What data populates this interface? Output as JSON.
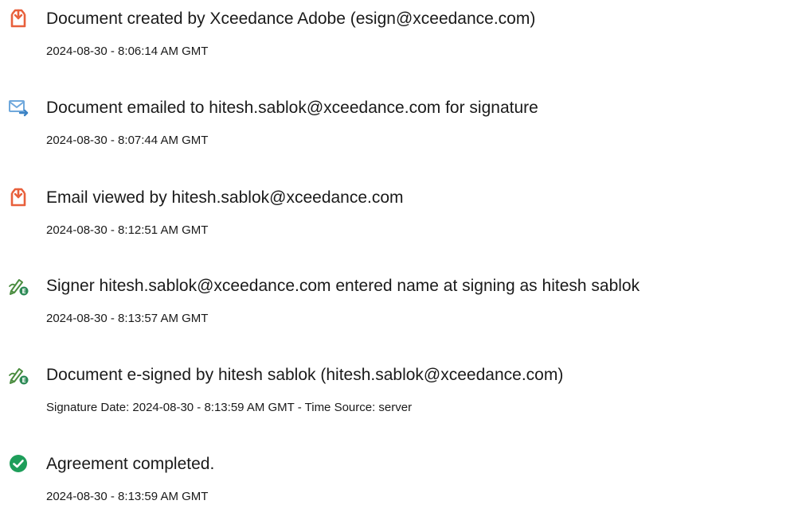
{
  "events": [
    {
      "icon": "document-created-icon",
      "title": "Document created by Xceedance Adobe (esign@xceedance.com)",
      "meta": "2024-08-30 - 8:06:14 AM GMT"
    },
    {
      "icon": "email-sent-icon",
      "title": "Document emailed to hitesh.sablok@xceedance.com for signature",
      "meta": "2024-08-30 - 8:07:44 AM GMT"
    },
    {
      "icon": "document-viewed-icon",
      "title": "Email viewed by hitesh.sablok@xceedance.com",
      "meta": "2024-08-30 - 8:12:51 AM GMT"
    },
    {
      "icon": "esign-pen-icon",
      "title": "Signer hitesh.sablok@xceedance.com entered name at signing as hitesh sablok",
      "meta": "2024-08-30 - 8:13:57 AM GMT"
    },
    {
      "icon": "esign-pen-icon",
      "title": "Document e-signed by hitesh sablok (hitesh.sablok@xceedance.com)",
      "meta": "Signature Date: 2024-08-30 - 8:13:59 AM GMT - Time Source: server"
    },
    {
      "icon": "check-circle-icon",
      "title": "Agreement completed.",
      "meta": "2024-08-30 - 8:13:59 AM GMT"
    }
  ],
  "colors": {
    "document_icon": "#e8603c",
    "email_icon": "#6fa8dc",
    "pen_icon": "#4a8c3f",
    "pen_badge": "#2e8b57",
    "complete_icon": "#1e9e5a",
    "text": "#1a1a1a"
  }
}
